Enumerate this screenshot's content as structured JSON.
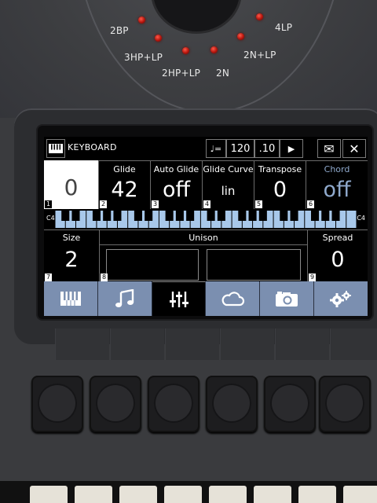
{
  "hardware": {
    "filter_modes": [
      "2BP",
      "4LP",
      "3HP+LP",
      "2N+LP",
      "2HP+LP",
      "2N"
    ]
  },
  "header": {
    "title": "KEYBOARD",
    "tempo_icon": "quarter-note-icon",
    "tempo_symbol": "♩=",
    "tempo": "120",
    "tempo_fraction": ".10",
    "play_symbol": "▶",
    "mail_symbol": "✉",
    "close_symbol": "✕"
  },
  "params": [
    {
      "label": "",
      "value": "0",
      "index": "1"
    },
    {
      "label": "Glide",
      "value": "42",
      "index": "2"
    },
    {
      "label": "Auto Glide",
      "value": "off",
      "index": "3"
    },
    {
      "label": "Glide Curve",
      "value": "lin",
      "index": "4"
    },
    {
      "label": "Transpose",
      "value": "0",
      "index": "5"
    },
    {
      "label": "Chord",
      "value": "off",
      "index": "6"
    }
  ],
  "keyboard": {
    "left_label": "C4",
    "right_label": "C4",
    "index": "7"
  },
  "row2": {
    "size_label": "Size",
    "size_value": "2",
    "size_index": "7",
    "unison_label": "Unison",
    "unison_index": "8",
    "spread_label": "Spread",
    "spread_value": "0",
    "spread_index": "9"
  },
  "tabs": [
    {
      "name": "keyboard-tab",
      "icon": "piano-icon",
      "active": false
    },
    {
      "name": "sequencer-tab",
      "icon": "music-notes-icon",
      "active": false
    },
    {
      "name": "mixer-tab",
      "icon": "sliders-icon",
      "active": true
    },
    {
      "name": "cloud-tab",
      "icon": "cloud-icon",
      "active": false
    },
    {
      "name": "camera-tab",
      "icon": "camera-icon",
      "active": false
    },
    {
      "name": "settings-tab",
      "icon": "gears-icon",
      "active": false
    }
  ],
  "colors": {
    "tab_bg": "#7b8fb0",
    "key_blue": "#a8c8ea",
    "selected_cell": "#ffffff",
    "chord_text": "#8fa9cc"
  }
}
